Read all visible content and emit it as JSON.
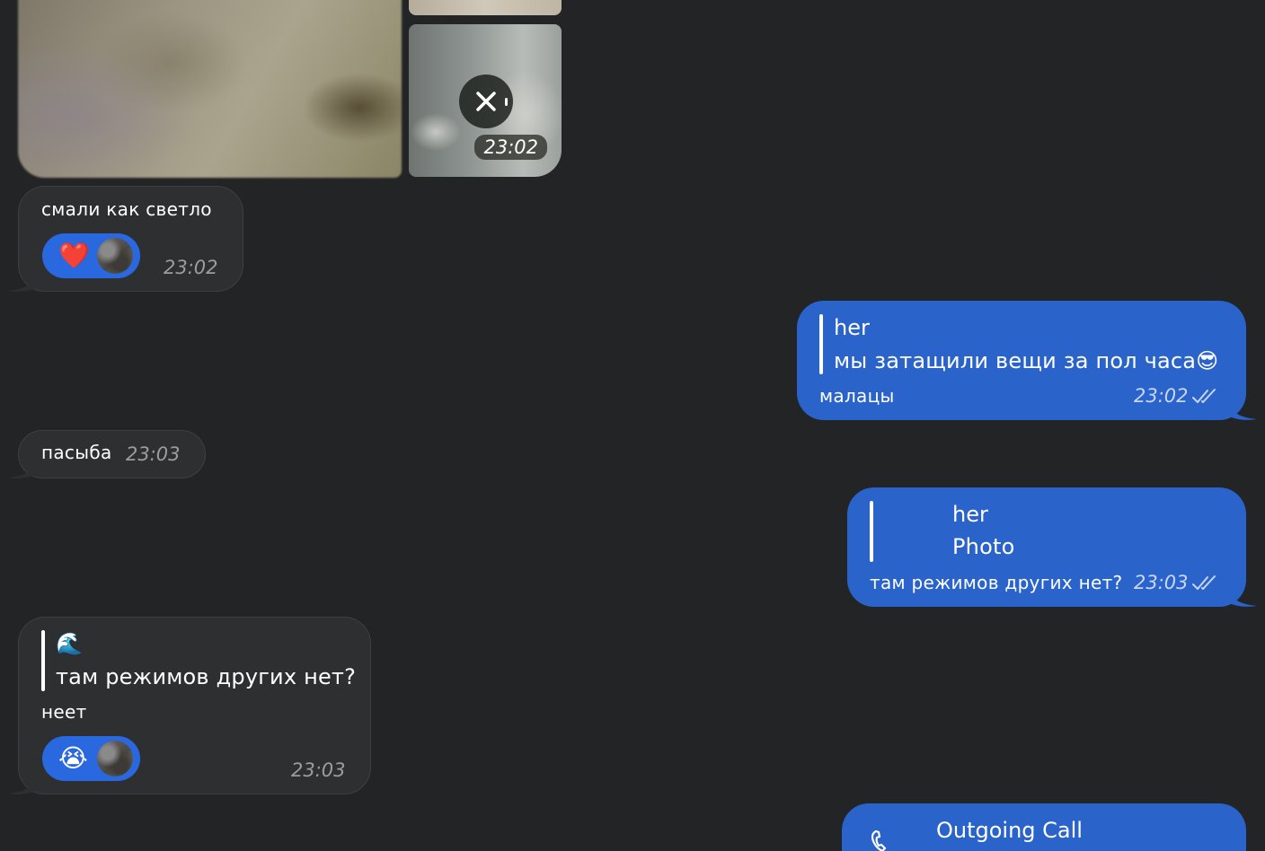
{
  "media_group": {
    "time": "23:02"
  },
  "messages": [
    {
      "id": "m1",
      "direction": "incoming",
      "text": "смали как светло",
      "time": "23:02",
      "reaction": {
        "emoji": "❤️"
      }
    },
    {
      "id": "m2",
      "direction": "outgoing",
      "reply": {
        "author": "her",
        "text": "мы затащили вещи за пол часа😎"
      },
      "text": "малацы",
      "time": "23:02",
      "status": "read"
    },
    {
      "id": "m3",
      "direction": "incoming",
      "text": "пасыба",
      "time": "23:03"
    },
    {
      "id": "m4",
      "direction": "outgoing",
      "reply": {
        "author": "her",
        "text": "Photo"
      },
      "text": "там режимов других нет?",
      "time": "23:03",
      "status": "read"
    },
    {
      "id": "m5",
      "direction": "incoming",
      "reply": {
        "author": "🌊",
        "text": "там режимов других нет?"
      },
      "text": "неет",
      "time": "23:03",
      "reaction": {
        "emoji": "😭"
      }
    },
    {
      "id": "m6",
      "direction": "outgoing",
      "call": {
        "title": "Outgoing Call"
      }
    }
  ],
  "colors": {
    "background": "#222426",
    "incoming_bubble": "#2e2f31",
    "outgoing_bubble": "#2a63c9",
    "reaction_pill": "#2a68e0"
  },
  "icons": [
    "close-icon",
    "read-checks-icon",
    "phone-icon",
    "reaction-avatar"
  ]
}
